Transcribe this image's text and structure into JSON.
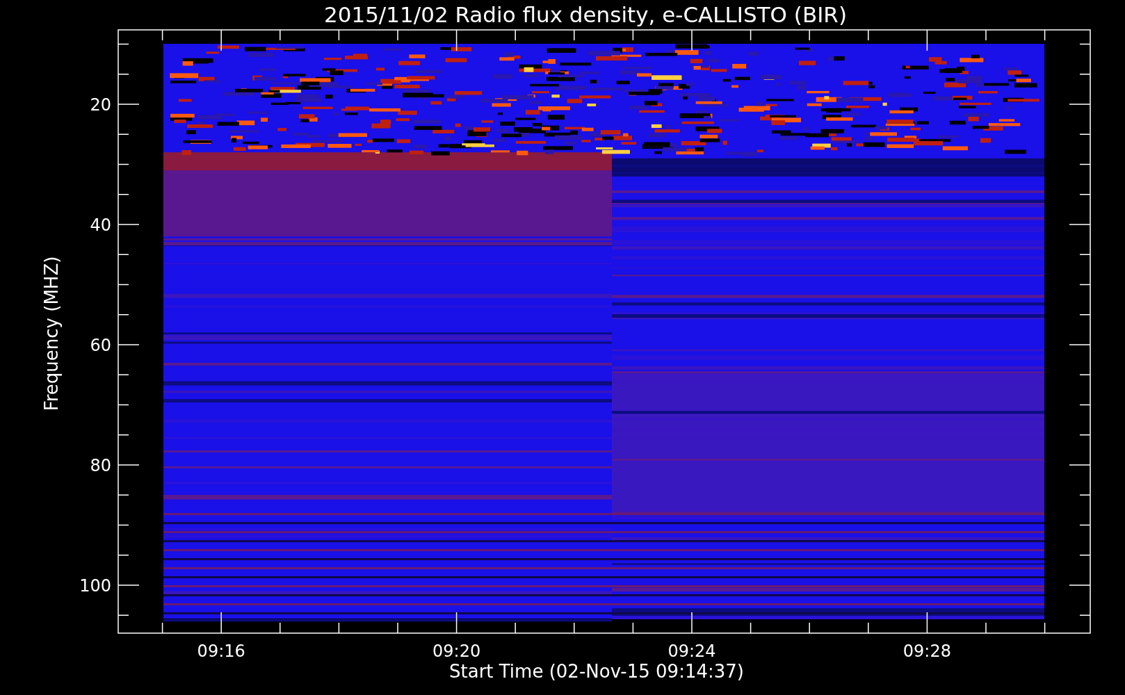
{
  "title": "2015/11/02  Radio flux density, e-CALLISTO (BIR)",
  "plot": {
    "ylabel": "Frequency (MHZ)",
    "xlabel": "Start Time (02-Nov-15 09:14:37)",
    "yticks": [
      "20",
      "40",
      "60",
      "80",
      "100"
    ],
    "xticks": [
      "09:16",
      "09:20",
      "09:24",
      "09:28"
    ]
  }
}
